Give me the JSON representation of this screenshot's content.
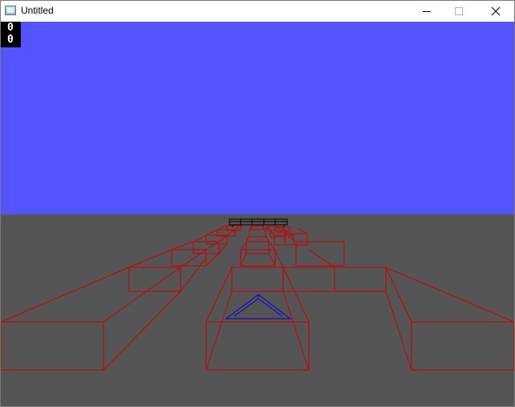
{
  "window": {
    "title": "Untitled",
    "icon": "app-window-icon"
  },
  "controls": {
    "minimize_icon": "minimize-icon",
    "maximize_icon": "maximize-icon",
    "close_icon": "close-icon"
  },
  "hud": {
    "line1": "0",
    "line2": "0"
  },
  "colors": {
    "sky": "#5555ff",
    "ground": "#555555",
    "obstacle_outline": "#cc0000",
    "player_outline": "#0000cc",
    "distant_outline": "#000000"
  }
}
